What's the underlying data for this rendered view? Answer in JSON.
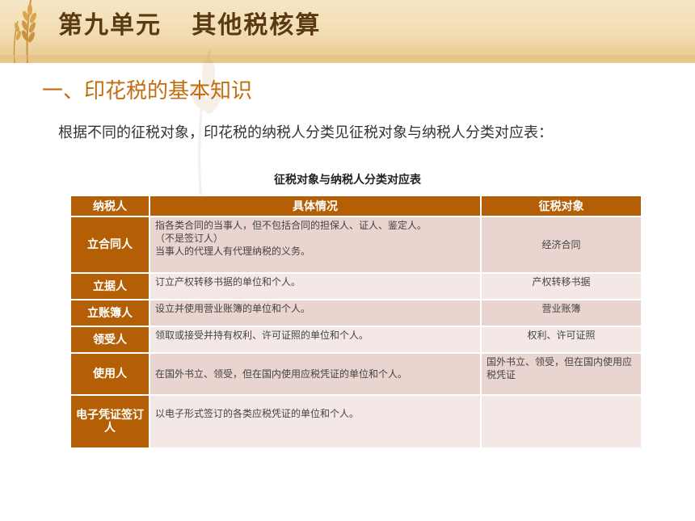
{
  "slide_title": "第九单元   其他税核算",
  "section_title": "一、印花税的基本知识",
  "intro_text": "根据不同的征税对象，印花税的纳税人分类见征税对象与纳税人分类对应表：",
  "table": {
    "caption": "征税对象与纳税人分类对应表",
    "headers": [
      "纳税人",
      "具体情况",
      "征税对象"
    ],
    "rows": [
      {
        "taxpayer": "立合同人",
        "detail": [
          "指各类合同的当事人，但不包括合同的担保人、证人、鉴定人。",
          "（不是签订人）",
          "当事人的代理人有代理纳税的义务。"
        ],
        "object": "经济合同"
      },
      {
        "taxpayer": "立据人",
        "detail": [
          "订立产权转移书据的单位和个人。"
        ],
        "object": "产权转移书据"
      },
      {
        "taxpayer": "立账簿人",
        "detail": [
          "设立并使用营业账簿的单位和个人。"
        ],
        "object": "营业账簿"
      },
      {
        "taxpayer": "领受人",
        "detail": [
          "领取或接受并持有权利、许可证照的单位和个人。"
        ],
        "object": "权利、许可证照"
      },
      {
        "taxpayer": "使用人",
        "detail": [
          "在国外书立、领受，但在国内使用应税凭证的单位和个人。"
        ],
        "object": "国外书立、领受，但在国内使用应税凭证"
      },
      {
        "taxpayer": "电子凭证签订人",
        "detail": [
          "以电子形式签订的各类应税凭证的单位和个人。"
        ],
        "object": ""
      }
    ]
  },
  "colors": {
    "accent": "#b45f06",
    "row_dark": "#e9d4cf",
    "row_light": "#f3e8e6",
    "title": "#5a3a12",
    "section": "#c26e10"
  }
}
